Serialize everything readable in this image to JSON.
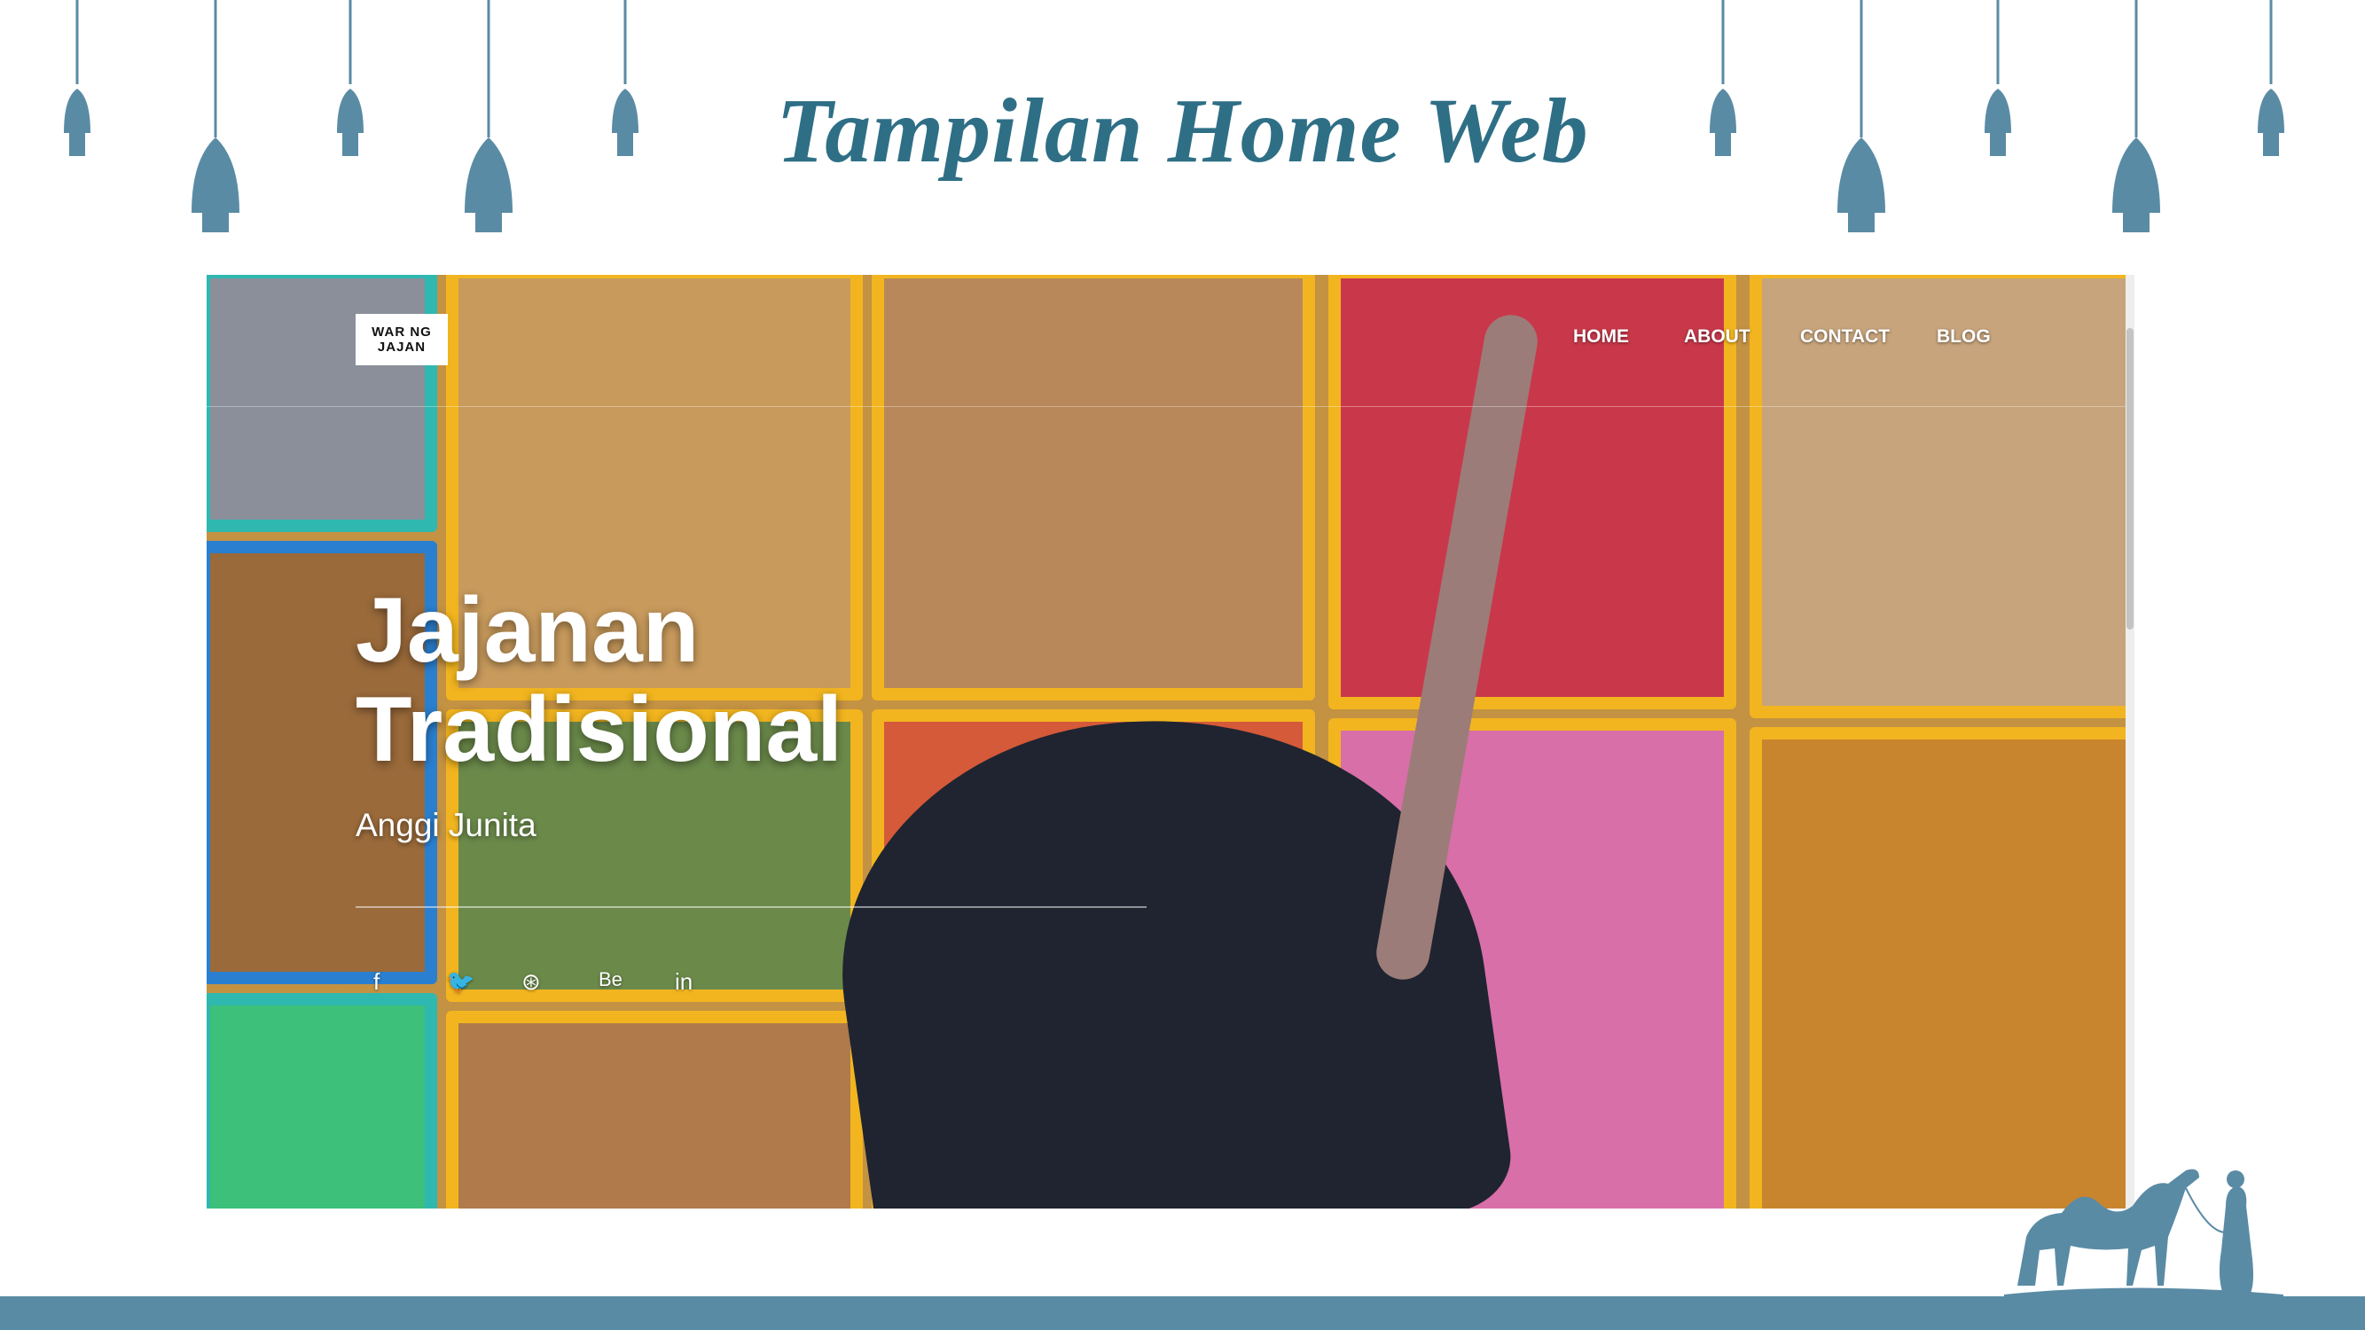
{
  "slide": {
    "title": "Tampilan Home Web",
    "colors": {
      "accent": "#2e6f86",
      "band": "#5a8ba5",
      "ornament": "#5a8ba5"
    }
  },
  "website": {
    "logo_line1": "WAR NG",
    "logo_line2": "JAJAN",
    "nav": [
      "HOME",
      "ABOUT",
      "CONTACT",
      "BLOG"
    ],
    "hero_title_line1": "Jajanan",
    "hero_title_line2": "Tradisional",
    "hero_subtitle": "Anggi Junita",
    "social_icons": [
      "facebook-icon",
      "twitter-icon",
      "dribbble-icon",
      "behance-icon",
      "linkedin-icon"
    ],
    "social_glyphs": [
      "f",
      "🐦",
      "⊛",
      "Be",
      "in"
    ]
  }
}
